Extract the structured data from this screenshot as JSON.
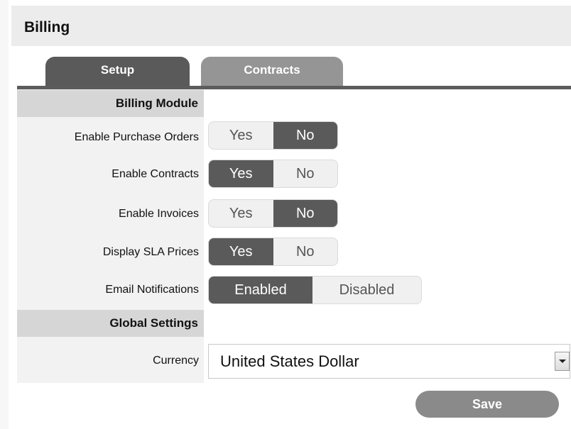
{
  "page": {
    "title": "Billing"
  },
  "tabs": [
    {
      "label": "Setup",
      "selected": true
    },
    {
      "label": "Contracts",
      "selected": false
    }
  ],
  "sections": {
    "billing_module": "Billing Module",
    "global_settings": "Global Settings"
  },
  "settings": {
    "purchase_orders": {
      "label": "Enable Purchase Orders",
      "options": [
        "Yes",
        "No"
      ],
      "selected": "No"
    },
    "contracts": {
      "label": "Enable Contracts",
      "options": [
        "Yes",
        "No"
      ],
      "selected": "Yes"
    },
    "invoices": {
      "label": "Enable Invoices",
      "options": [
        "Yes",
        "No"
      ],
      "selected": "No"
    },
    "sla_prices": {
      "label": "Display SLA Prices",
      "options": [
        "Yes",
        "No"
      ],
      "selected": "Yes"
    },
    "email_notifications": {
      "label": "Email Notifications",
      "options": [
        "Enabled",
        "Disabled"
      ],
      "selected": "Enabled"
    }
  },
  "currency": {
    "label": "Currency",
    "value": "United States Dollar"
  },
  "buttons": {
    "save": "Save"
  },
  "colors": {
    "active": "#5a5a5a",
    "tab_inactive": "#959595",
    "save": "#8a8a8a",
    "section_header": "#d6d6d6"
  },
  "icons": {
    "dropdown": "chevron-down-icon"
  }
}
